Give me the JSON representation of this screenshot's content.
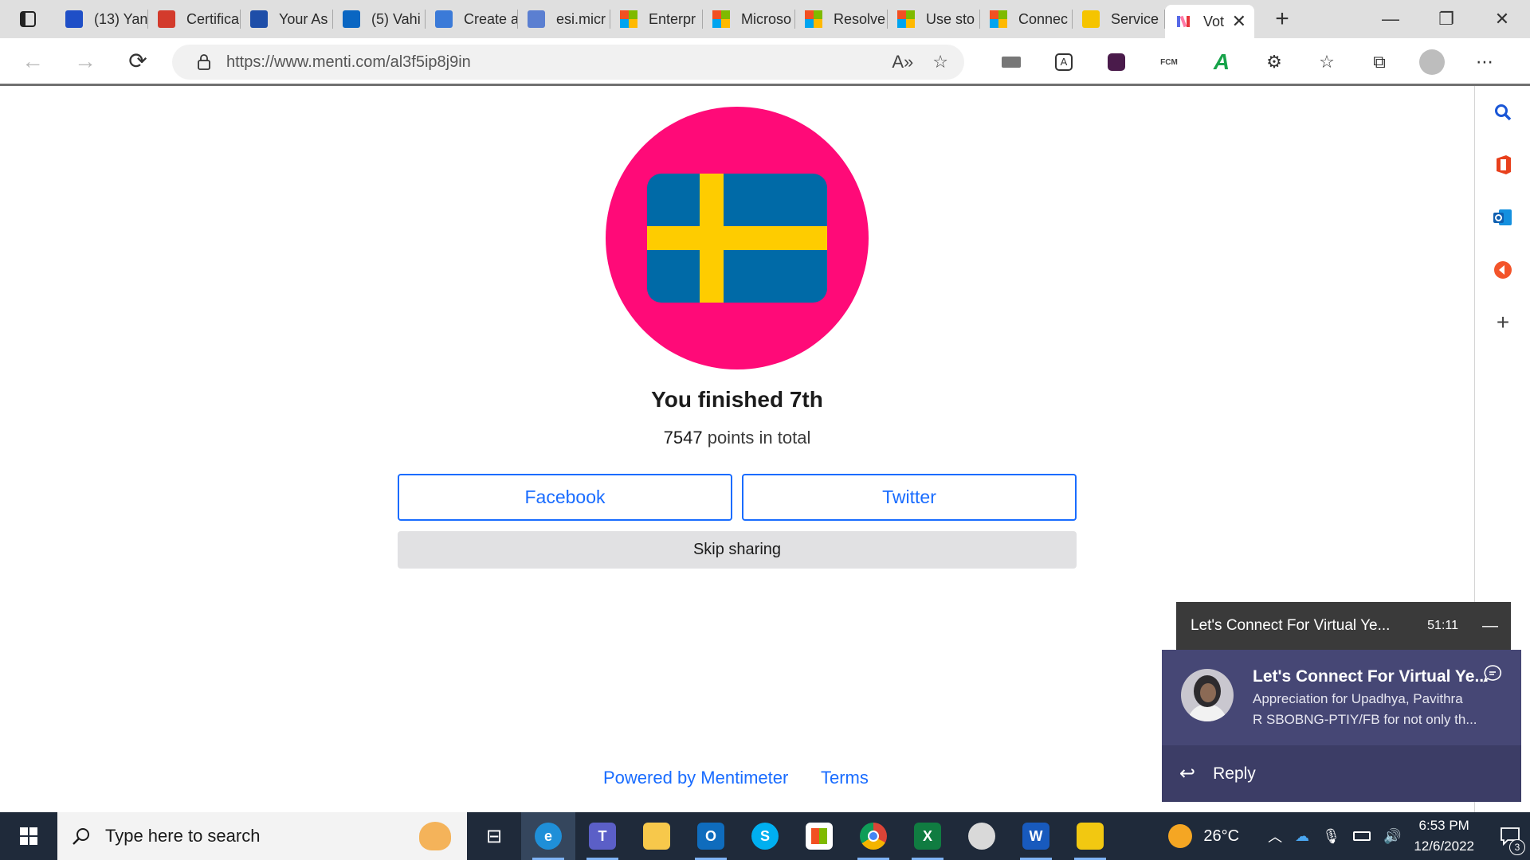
{
  "browser": {
    "tabs": [
      {
        "title": "(13) Yan",
        "icon": "viva-engage-icon",
        "color": "#1f4fc7"
      },
      {
        "title": "Certifica",
        "icon": "pdf-icon",
        "color": "#d33b2c"
      },
      {
        "title": "Your As",
        "icon": "stream-video-icon",
        "color": "#1e4ea8"
      },
      {
        "title": "(5) Vahi",
        "icon": "linkedin-icon",
        "color": "#0a66c2"
      },
      {
        "title": "Create a",
        "icon": "azure-icon",
        "color": "#3b7ad8"
      },
      {
        "title": "esi.micr",
        "icon": "search-icon",
        "color": "#5b7fd1"
      },
      {
        "title": "Enterpr",
        "icon": "microsoft-logo-icon",
        "color": "#f25022"
      },
      {
        "title": "Microso",
        "icon": "microsoft-logo-icon",
        "color": "#f25022"
      },
      {
        "title": "Resolve",
        "icon": "microsoft-logo-icon",
        "color": "#f25022"
      },
      {
        "title": "Use sto",
        "icon": "microsoft-logo-icon",
        "color": "#f25022"
      },
      {
        "title": "Connec",
        "icon": "microsoft-logo-icon",
        "color": "#f25022"
      },
      {
        "title": "Service",
        "icon": "shell-icon",
        "color": "#f5c400"
      }
    ],
    "active_tab": {
      "title": "Vot",
      "icon": "mentimeter-icon"
    },
    "url": "https://www.menti.com/al3f5ip8j9in"
  },
  "page": {
    "result_title": "You finished 7th",
    "points_value": "7547",
    "points_suffix": " points in total",
    "facebook_label": "Facebook",
    "twitter_label": "Twitter",
    "skip_label": "Skip sharing",
    "powered_by": "Powered by Mentimeter",
    "terms": "Terms"
  },
  "colors": {
    "accent": "#196cff",
    "avatar_bg": "#ff0a78",
    "flag_blue": "#006aa7",
    "flag_yellow": "#fecc00",
    "teams_purple": "#464775"
  },
  "teams": {
    "mini_title": "Let's Connect For Virtual Ye...",
    "mini_time": "51:11",
    "toast_title": "Let's Connect For Virtual Ye...",
    "toast_line1": "Appreciation for Upadhya, Pavithra",
    "toast_line2": "R SBOBNG-PTIY/FB for not only th...",
    "reply_label": "Reply"
  },
  "taskbar": {
    "search_placeholder": "Type here to search",
    "weather": "26°C",
    "time": "6:53 PM",
    "date": "12/6/2022",
    "notification_count": "3"
  }
}
